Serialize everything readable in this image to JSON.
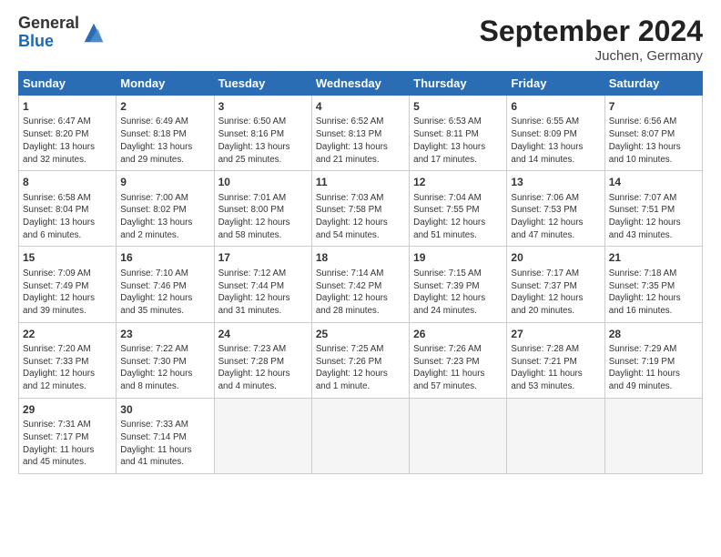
{
  "header": {
    "logo_general": "General",
    "logo_blue": "Blue",
    "month_title": "September 2024",
    "location": "Juchen, Germany"
  },
  "weekdays": [
    "Sunday",
    "Monday",
    "Tuesday",
    "Wednesday",
    "Thursday",
    "Friday",
    "Saturday"
  ],
  "weeks": [
    [
      {
        "day": "1",
        "info": "Sunrise: 6:47 AM\nSunset: 8:20 PM\nDaylight: 13 hours\nand 32 minutes."
      },
      {
        "day": "2",
        "info": "Sunrise: 6:49 AM\nSunset: 8:18 PM\nDaylight: 13 hours\nand 29 minutes."
      },
      {
        "day": "3",
        "info": "Sunrise: 6:50 AM\nSunset: 8:16 PM\nDaylight: 13 hours\nand 25 minutes."
      },
      {
        "day": "4",
        "info": "Sunrise: 6:52 AM\nSunset: 8:13 PM\nDaylight: 13 hours\nand 21 minutes."
      },
      {
        "day": "5",
        "info": "Sunrise: 6:53 AM\nSunset: 8:11 PM\nDaylight: 13 hours\nand 17 minutes."
      },
      {
        "day": "6",
        "info": "Sunrise: 6:55 AM\nSunset: 8:09 PM\nDaylight: 13 hours\nand 14 minutes."
      },
      {
        "day": "7",
        "info": "Sunrise: 6:56 AM\nSunset: 8:07 PM\nDaylight: 13 hours\nand 10 minutes."
      }
    ],
    [
      {
        "day": "8",
        "info": "Sunrise: 6:58 AM\nSunset: 8:04 PM\nDaylight: 13 hours\nand 6 minutes."
      },
      {
        "day": "9",
        "info": "Sunrise: 7:00 AM\nSunset: 8:02 PM\nDaylight: 13 hours\nand 2 minutes."
      },
      {
        "day": "10",
        "info": "Sunrise: 7:01 AM\nSunset: 8:00 PM\nDaylight: 12 hours\nand 58 minutes."
      },
      {
        "day": "11",
        "info": "Sunrise: 7:03 AM\nSunset: 7:58 PM\nDaylight: 12 hours\nand 54 minutes."
      },
      {
        "day": "12",
        "info": "Sunrise: 7:04 AM\nSunset: 7:55 PM\nDaylight: 12 hours\nand 51 minutes."
      },
      {
        "day": "13",
        "info": "Sunrise: 7:06 AM\nSunset: 7:53 PM\nDaylight: 12 hours\nand 47 minutes."
      },
      {
        "day": "14",
        "info": "Sunrise: 7:07 AM\nSunset: 7:51 PM\nDaylight: 12 hours\nand 43 minutes."
      }
    ],
    [
      {
        "day": "15",
        "info": "Sunrise: 7:09 AM\nSunset: 7:49 PM\nDaylight: 12 hours\nand 39 minutes."
      },
      {
        "day": "16",
        "info": "Sunrise: 7:10 AM\nSunset: 7:46 PM\nDaylight: 12 hours\nand 35 minutes."
      },
      {
        "day": "17",
        "info": "Sunrise: 7:12 AM\nSunset: 7:44 PM\nDaylight: 12 hours\nand 31 minutes."
      },
      {
        "day": "18",
        "info": "Sunrise: 7:14 AM\nSunset: 7:42 PM\nDaylight: 12 hours\nand 28 minutes."
      },
      {
        "day": "19",
        "info": "Sunrise: 7:15 AM\nSunset: 7:39 PM\nDaylight: 12 hours\nand 24 minutes."
      },
      {
        "day": "20",
        "info": "Sunrise: 7:17 AM\nSunset: 7:37 PM\nDaylight: 12 hours\nand 20 minutes."
      },
      {
        "day": "21",
        "info": "Sunrise: 7:18 AM\nSunset: 7:35 PM\nDaylight: 12 hours\nand 16 minutes."
      }
    ],
    [
      {
        "day": "22",
        "info": "Sunrise: 7:20 AM\nSunset: 7:33 PM\nDaylight: 12 hours\nand 12 minutes."
      },
      {
        "day": "23",
        "info": "Sunrise: 7:22 AM\nSunset: 7:30 PM\nDaylight: 12 hours\nand 8 minutes."
      },
      {
        "day": "24",
        "info": "Sunrise: 7:23 AM\nSunset: 7:28 PM\nDaylight: 12 hours\nand 4 minutes."
      },
      {
        "day": "25",
        "info": "Sunrise: 7:25 AM\nSunset: 7:26 PM\nDaylight: 12 hours\nand 1 minute."
      },
      {
        "day": "26",
        "info": "Sunrise: 7:26 AM\nSunset: 7:23 PM\nDaylight: 11 hours\nand 57 minutes."
      },
      {
        "day": "27",
        "info": "Sunrise: 7:28 AM\nSunset: 7:21 PM\nDaylight: 11 hours\nand 53 minutes."
      },
      {
        "day": "28",
        "info": "Sunrise: 7:29 AM\nSunset: 7:19 PM\nDaylight: 11 hours\nand 49 minutes."
      }
    ],
    [
      {
        "day": "29",
        "info": "Sunrise: 7:31 AM\nSunset: 7:17 PM\nDaylight: 11 hours\nand 45 minutes."
      },
      {
        "day": "30",
        "info": "Sunrise: 7:33 AM\nSunset: 7:14 PM\nDaylight: 11 hours\nand 41 minutes."
      },
      {
        "day": "",
        "info": ""
      },
      {
        "day": "",
        "info": ""
      },
      {
        "day": "",
        "info": ""
      },
      {
        "day": "",
        "info": ""
      },
      {
        "day": "",
        "info": ""
      }
    ]
  ]
}
